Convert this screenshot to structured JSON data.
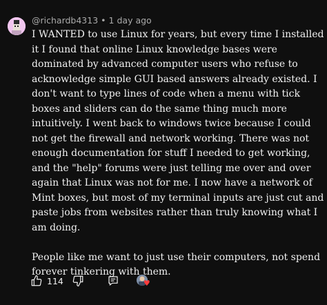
{
  "comment": {
    "author": "@richardb4313",
    "separator": "•",
    "time": "1 day ago",
    "paragraph_1": "I WANTED to use Linux for years, but every time I installed it I found that online Linux knowledge bases were dominated by advanced computer users who refuse to acknowledge simple GUI based answers already existed.  I don't want to type lines of code when a menu with tick boxes and sliders can do the same thing much more intuitively.  I went back to windows twice because I could not get the firewall and network working.  There was not enough documentation for stuff I needed to get working, and the \"help\" forums were just telling me over and over again that Linux was not for me.   I now have a network of Mint boxes, but most of my terminal inputs are just cut and paste jobs from websites rather than truly knowing what I am doing.",
    "paragraph_2": "People like me want to just use their computers, not spend forever tinkering with them."
  },
  "actions": {
    "like_count": "114",
    "like_icon": "thumbs-up-icon",
    "dislike_icon": "thumbs-down-icon",
    "reply_icon": "reply-comment-icon",
    "creator_heart_icon": "creator-heart-icon"
  },
  "colors": {
    "background": "#0f0f0f",
    "text": "#f1f1f1",
    "meta": "#aaaaaa",
    "avatar_bg": "#f2c6ef",
    "heart": "#ff3b3b"
  }
}
